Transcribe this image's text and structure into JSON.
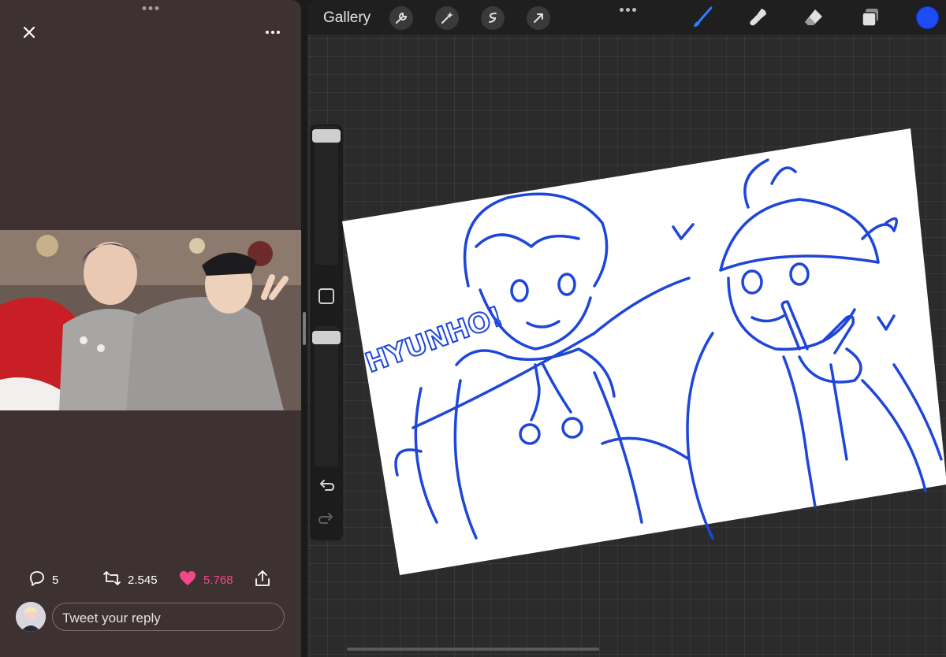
{
  "twitter": {
    "stats": {
      "replies": "5",
      "retweets": "2.545",
      "likes": "5.768"
    },
    "reply_placeholder": "Tweet your reply",
    "colors": {
      "background": "#3d3131",
      "like": "#f0498a"
    },
    "icons": [
      "close-icon",
      "more-icon",
      "reply-icon",
      "retweet-icon",
      "heart-icon",
      "share-icon"
    ]
  },
  "procreate": {
    "gallery_label": "Gallery",
    "tools": [
      "wrench-icon",
      "magic-wand-icon",
      "selection-icon",
      "transform-icon",
      "brush-icon",
      "smudge-icon",
      "eraser-icon",
      "layers-icon"
    ],
    "active_tool": "brush",
    "colors": {
      "brush_color": "#1f4cf2",
      "active_tool": "#2f7fff"
    },
    "canvas_text": "HYUNHO!"
  }
}
